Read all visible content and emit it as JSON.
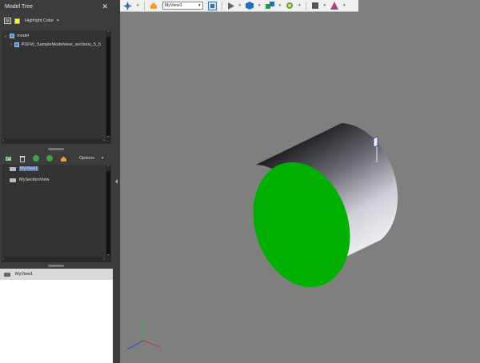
{
  "panel": {
    "title": "Model Tree",
    "close_glyph": "✕",
    "highlight_label": "Highlight Color",
    "tree": {
      "root": "model",
      "child": "PDFW_SampleModelview_sections_5_5"
    },
    "views_toolbar": {
      "options_label": "Options"
    },
    "views": [
      "MyView1",
      "MySectionView"
    ],
    "props": {
      "selected_view": "MyView1"
    }
  },
  "toolbar": {
    "current_view": "MyView1",
    "icons": [
      "navigate-icon",
      "home-icon",
      "view-select",
      "fit-icon",
      "play-icon",
      "cube-icon",
      "cubes-icon",
      "lights-icon",
      "render-mode-icon",
      "background-icon"
    ]
  },
  "colors": {
    "viewport_bg": "#7f7f7f",
    "section_face": "#00b000",
    "panel_bg": "#3c3c3c",
    "highlight_color": "#ffff00"
  }
}
